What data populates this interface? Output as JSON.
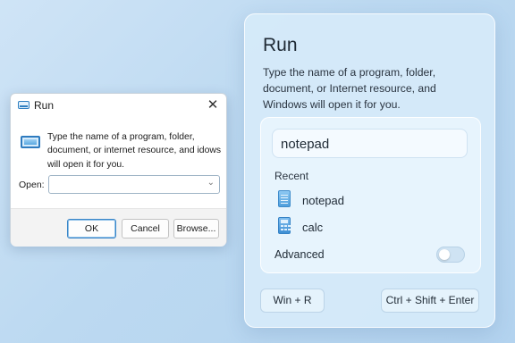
{
  "classic_dialog": {
    "title": "Run",
    "close_glyph": "✕",
    "description": "Type the name of a program, folder, document, or internet resource, and idows will open it for you.",
    "open_label": "Open:",
    "open_value": "",
    "buttons": {
      "ok": "OK",
      "cancel": "Cancel",
      "browse": "Browse..."
    }
  },
  "modern_panel": {
    "title": "Run",
    "description": "Type the name of a program, folder, document, or Internet resource, and Windows will open it for you.",
    "input_value": "notepad",
    "recent_label": "Recent",
    "recent_items": [
      {
        "label": "notepad",
        "icon": "notepad-icon"
      },
      {
        "label": "calc",
        "icon": "calculator-icon"
      }
    ],
    "advanced_label": "Advanced",
    "advanced_enabled": false,
    "shortcuts": {
      "win_r": "Win + R",
      "ctrl_shift_enter": "Ctrl + Shift + Enter"
    }
  },
  "colors": {
    "accent": "#2f7fc1",
    "background": "#c4ddf3"
  }
}
